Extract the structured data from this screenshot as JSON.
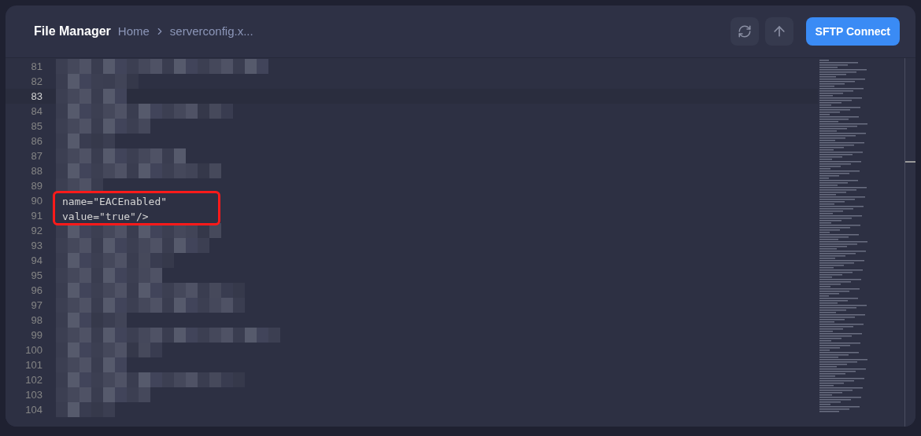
{
  "header": {
    "title": "File Manager",
    "breadcrumb": [
      "Home",
      "serverconfig.x..."
    ],
    "buttons": [
      {
        "kind": "refresh"
      },
      {
        "kind": "upload"
      }
    ],
    "connect_button": "SFTP Connect"
  },
  "editor": {
    "lines": [
      {
        "number": "81",
        "kind": "redacted",
        "active": false,
        "marked": false
      },
      {
        "number": "82",
        "kind": "redacted",
        "active": false,
        "marked": false
      },
      {
        "number": "83",
        "kind": "redacted",
        "active": true,
        "marked": false
      },
      {
        "number": "84",
        "kind": "redacted",
        "active": false,
        "marked": false
      },
      {
        "number": "85",
        "kind": "redacted",
        "active": false,
        "marked": false
      },
      {
        "number": "86",
        "kind": "redacted",
        "active": false,
        "marked": false
      },
      {
        "number": "87",
        "kind": "redacted",
        "active": false,
        "marked": false
      },
      {
        "number": "88",
        "kind": "redacted",
        "active": false,
        "marked": false
      },
      {
        "number": "89",
        "kind": "redacted",
        "active": false,
        "marked": false
      },
      {
        "number": "90",
        "kind": "code",
        "text": "name=\"EACEnabled\"",
        "active": false,
        "marked": true
      },
      {
        "number": "91",
        "kind": "code",
        "text": "value=\"true\"/>",
        "active": false,
        "marked": true
      },
      {
        "number": "92",
        "kind": "redacted",
        "active": false,
        "marked": false
      },
      {
        "number": "93",
        "kind": "redacted",
        "active": false,
        "marked": false
      },
      {
        "number": "94",
        "kind": "redacted",
        "active": false,
        "marked": false
      },
      {
        "number": "95",
        "kind": "redacted",
        "active": false,
        "marked": false
      },
      {
        "number": "96",
        "kind": "redacted",
        "active": false,
        "marked": false
      },
      {
        "number": "97",
        "kind": "redacted",
        "active": false,
        "marked": false
      },
      {
        "number": "98",
        "kind": "redacted",
        "active": false,
        "marked": false
      },
      {
        "number": "99",
        "kind": "redacted",
        "active": false,
        "marked": false
      },
      {
        "number": "100",
        "kind": "redacted",
        "active": false,
        "marked": false
      },
      {
        "number": "101",
        "kind": "redacted",
        "active": false,
        "marked": false
      },
      {
        "number": "102",
        "kind": "redacted",
        "active": false,
        "marked": false
      },
      {
        "number": "103",
        "kind": "redacted",
        "active": false,
        "marked": false
      },
      {
        "number": "104",
        "kind": "redacted",
        "active": false,
        "marked": false
      }
    ]
  }
}
